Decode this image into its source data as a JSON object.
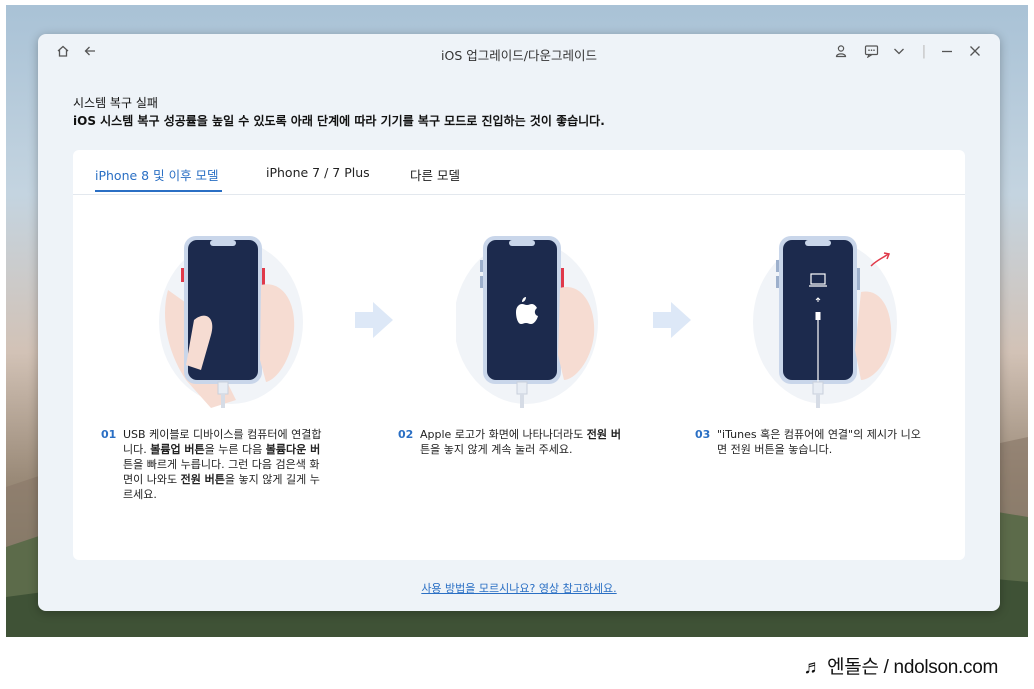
{
  "window": {
    "title": "iOS 업그레이드/다운그레이드"
  },
  "icons": {
    "home": "home-icon",
    "back": "back-arrow-icon",
    "user": "user-icon",
    "feedback": "chat-icon",
    "dropdown": "chevron-down-icon",
    "minimize": "minimize-icon",
    "close": "close-icon"
  },
  "page": {
    "heading": "시스템 복구 실패",
    "subheading": "iOS 시스템 복구 성공률을 높일 수 있도록 아래 단계에 따라 기기를 복구 모드로 진입하는 것이 좋습니다."
  },
  "tabs": [
    {
      "label": "iPhone 8 및 이후 모델",
      "active": true
    },
    {
      "label": "iPhone 7 / 7 Plus",
      "active": false
    },
    {
      "label": "다른 모델",
      "active": false
    }
  ],
  "steps": [
    {
      "num": "01",
      "lines": [
        "USB 케이블로 디바이스를 컴퓨터에 연결합",
        "니다. ",
        "볼륨업 버튼",
        "을 누른 다음 ",
        "볼륨다운 버",
        "튼을 빠르게 누릅니다. 그런 다음 검은색 화",
        "면이 나와도 ",
        "전원 버튼",
        "을 놓지 않게 길게 누",
        "르세요."
      ]
    },
    {
      "num": "02",
      "lines": [
        "Apple 로고가 화면에 나타나더라도 ",
        "전원 버",
        "튼을 놓지 않게 계속 눌러 주세요."
      ]
    },
    {
      "num": "03",
      "lines": [
        "\"iTunes 혹은 컴퓨어에 연결\"의 제시가 니오",
        "면 전원 버튼을 놓습니다."
      ]
    }
  ],
  "help_link": "사용 방법을 모르시나요? 영상 참고하세요.",
  "watermark": "♬ 엔돌슨 / ndolson.com",
  "colors": {
    "accent": "#2a6fc4",
    "phone_screen": "#1c2a4d",
    "button_highlight": "#e0394a"
  }
}
